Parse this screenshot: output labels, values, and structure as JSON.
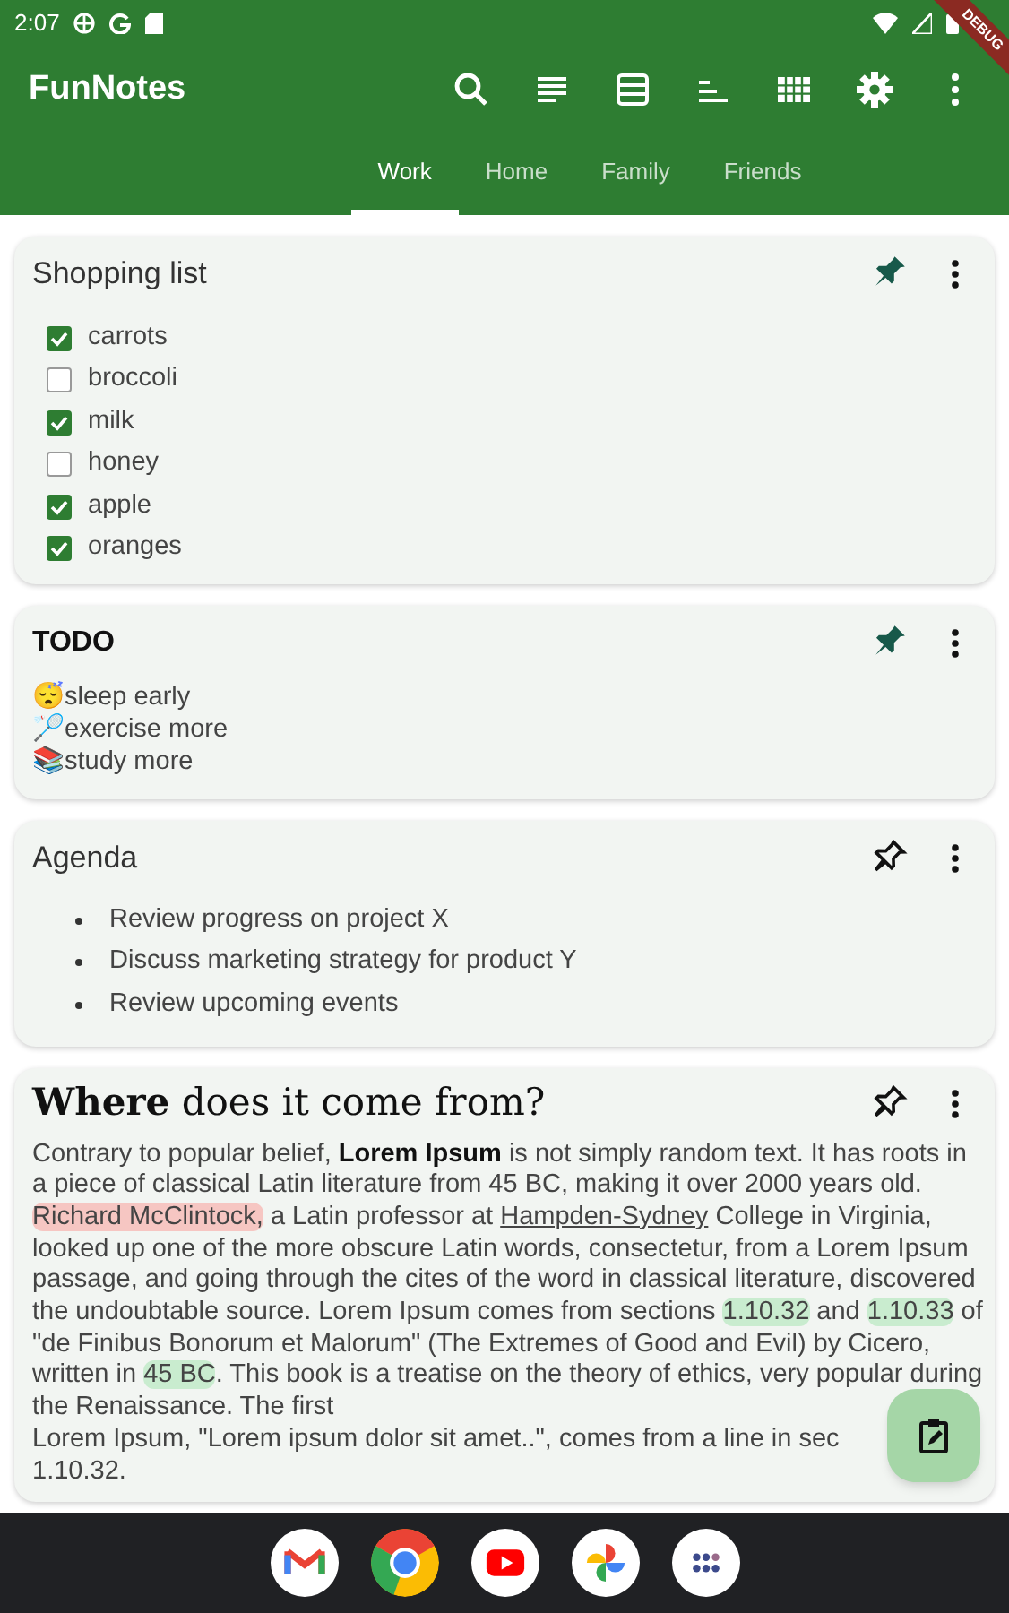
{
  "status_bar": {
    "time": "2:07"
  },
  "debug_banner": "DEBUG",
  "app_bar": {
    "title": "FunNotes"
  },
  "tabs": [
    {
      "label": "Work",
      "selected": true
    },
    {
      "label": "Home",
      "selected": false
    },
    {
      "label": "Family",
      "selected": false
    },
    {
      "label": "Friends",
      "selected": false
    }
  ],
  "notes": [
    {
      "kind": "checklist",
      "title": "Shopping list",
      "pinned": true,
      "items": [
        {
          "label": "carrots",
          "checked": true
        },
        {
          "label": "broccoli",
          "checked": false
        },
        {
          "label": "milk",
          "checked": true
        },
        {
          "label": "honey",
          "checked": false
        },
        {
          "label": "apple",
          "checked": true
        },
        {
          "label": "oranges",
          "checked": true
        }
      ]
    },
    {
      "kind": "text",
      "title": "TODO",
      "pinned": true,
      "lines": [
        "😴sleep early",
        "🏸exercise more",
        "📚study more"
      ]
    },
    {
      "kind": "bullets",
      "title": "Agenda",
      "pinned": false,
      "items": [
        "Review progress on project X",
        "Discuss marketing strategy for product Y",
        "Review upcoming events"
      ]
    },
    {
      "kind": "rich",
      "title": "**Where** does it come from?",
      "pinned": false,
      "segments": [
        {
          "kind": "plain",
          "text": "Contrary to popular belief, "
        },
        {
          "kind": "bold",
          "text": "Lorem Ipsum"
        },
        {
          "kind": "plain",
          "text": " is not simply random text. It has roots in a piece of classical Latin literature from 45 BC, making it over 2000 years old. "
        },
        {
          "kind": "highlight",
          "color": "#f6c6c2",
          "text": "Richard McClintock,"
        },
        {
          "kind": "plain",
          "text": " a Latin professor at "
        },
        {
          "kind": "underline",
          "text": "Hampden-Sydney"
        },
        {
          "kind": "plain",
          "text": " College in Virginia, looked up one of the more obscure Latin words, consectetur, from a Lorem Ipsum passage, and going through the cites of the word in classical literature, discovered the undoubtable source. Lorem Ipsum comes from sections "
        },
        {
          "kind": "highlight",
          "color": "#c9eccf",
          "text": "1.10.32"
        },
        {
          "kind": "plain",
          "text": " and "
        },
        {
          "kind": "highlight",
          "color": "#c9eccf",
          "text": "1.10.33"
        },
        {
          "kind": "plain",
          "text": " of \"de Finibus Bonorum et Malorum\" (The Extremes of Good and Evil) by Cicero, written in "
        },
        {
          "kind": "highlight",
          "color": "#c9eccf",
          "text": "45 BC"
        },
        {
          "kind": "plain",
          "text": ". This book is a treatise on the theory of ethics, very popular during the Renaissance. The first",
          "line_break_after": true
        },
        {
          "kind": "plain",
          "text": "Lorem Ipsum, \"Lorem ipsum dolor sit amet..\", comes from a line in sec",
          "line_break_after": true
        },
        {
          "kind": "plain",
          "text": "1.10.32."
        }
      ]
    }
  ]
}
